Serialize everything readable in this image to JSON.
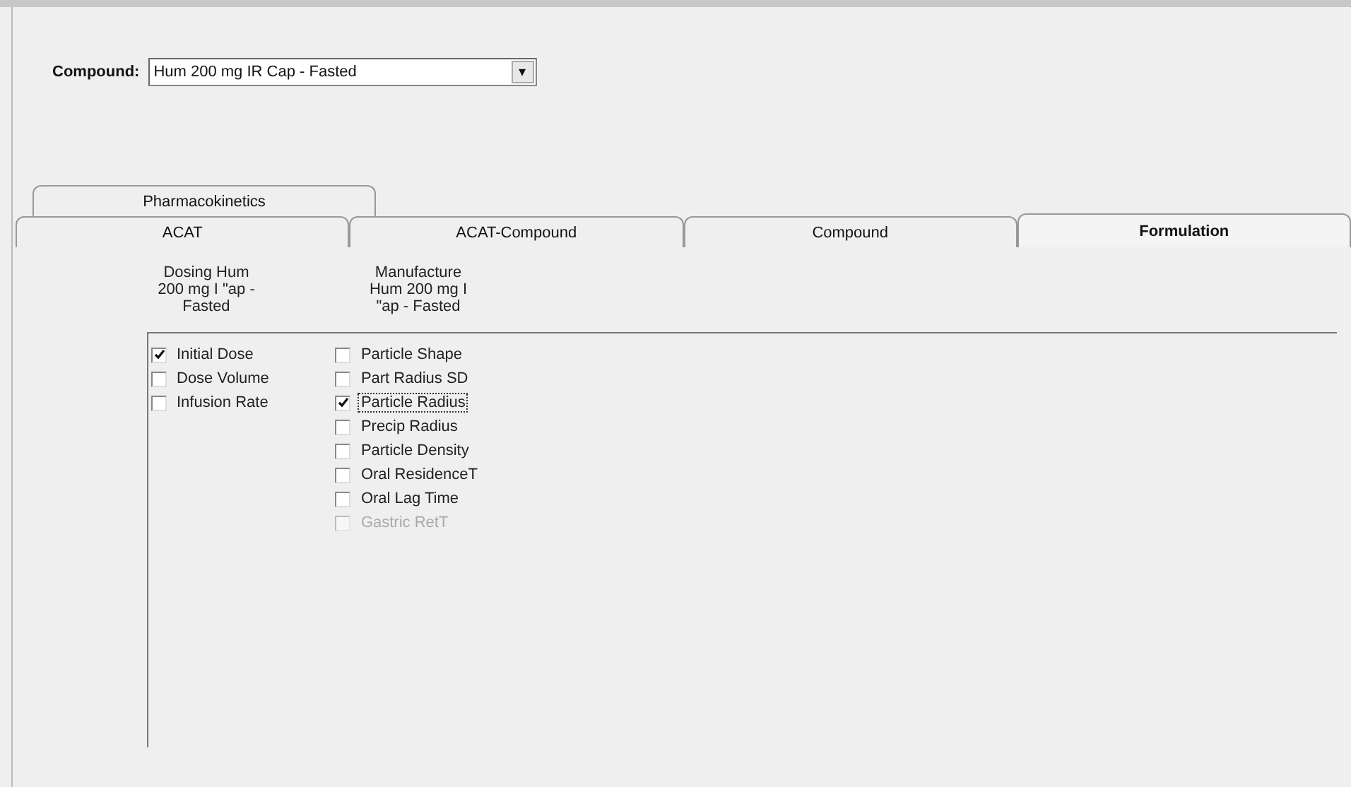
{
  "compound": {
    "label": "Compound:",
    "value": "Hum 200 mg IR Cap - Fasted",
    "arrow": "▾"
  },
  "upper_tabs": [
    {
      "label": "Pharmacokinetics",
      "selected": false
    }
  ],
  "tabs": [
    {
      "label": "ACAT",
      "selected": false
    },
    {
      "label": "ACAT-Compound",
      "selected": false
    },
    {
      "label": "Compound",
      "selected": false
    },
    {
      "label": "Formulation",
      "selected": true
    }
  ],
  "groups": [
    {
      "heading": [
        "Dosing Hum",
        "200 mg I \"ap -",
        "Fasted"
      ],
      "items": [
        {
          "label": "Initial Dose",
          "checked": true,
          "disabled": false,
          "focused": false
        },
        {
          "label": "Dose Volume",
          "checked": false,
          "disabled": false,
          "focused": false
        },
        {
          "label": "Infusion Rate",
          "checked": false,
          "disabled": false,
          "focused": false
        }
      ]
    },
    {
      "heading": [
        "Manufacture",
        "Hum 200 mg I",
        "\"ap - Fasted"
      ],
      "items": [
        {
          "label": "Particle Shape",
          "checked": false,
          "disabled": false,
          "focused": false
        },
        {
          "label": "Part Radius SD",
          "checked": false,
          "disabled": false,
          "focused": false
        },
        {
          "label": "Particle Radius",
          "checked": true,
          "disabled": false,
          "focused": true
        },
        {
          "label": "Precip Radius",
          "checked": false,
          "disabled": false,
          "focused": false
        },
        {
          "label": "Particle Density",
          "checked": false,
          "disabled": false,
          "focused": false
        },
        {
          "label": "Oral ResidenceT",
          "checked": false,
          "disabled": false,
          "focused": false
        },
        {
          "label": "Oral Lag Time",
          "checked": false,
          "disabled": false,
          "focused": false
        },
        {
          "label": "Gastric RetT",
          "checked": false,
          "disabled": true,
          "focused": false
        }
      ]
    }
  ]
}
